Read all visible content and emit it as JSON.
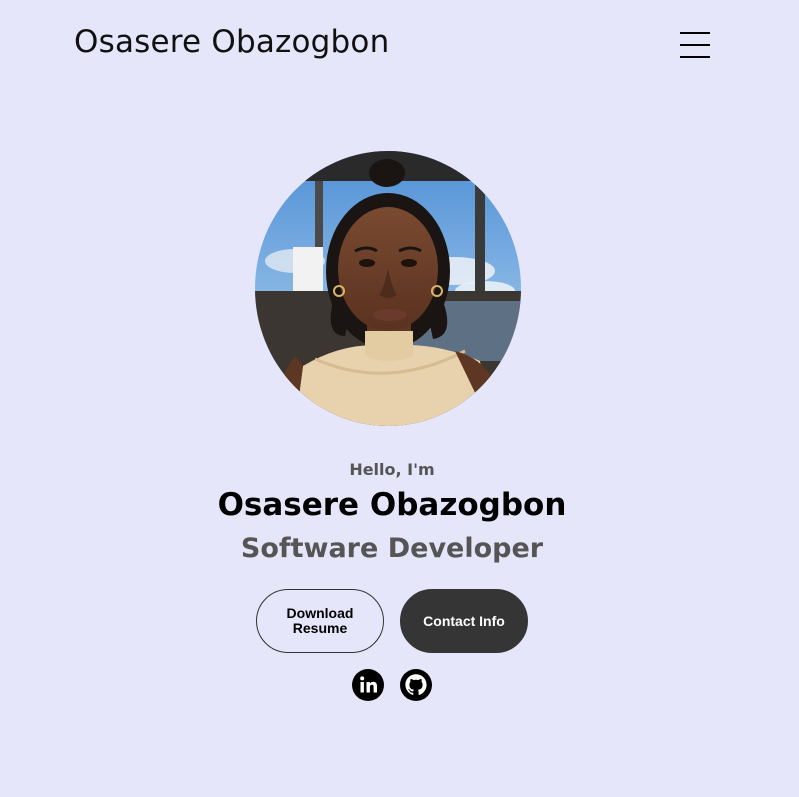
{
  "header": {
    "logo": "Osasere Obazogbon",
    "menu_icon": "hamburger-menu-icon"
  },
  "hero": {
    "greeting": "Hello, I'm",
    "name": "Osasere Obazogbon",
    "role": "Software Developer"
  },
  "buttons": {
    "resume_label": "Download Resume",
    "contact_label": "Contact Info"
  },
  "socials": [
    {
      "icon": "linkedin-icon"
    },
    {
      "icon": "github-icon"
    }
  ],
  "colors": {
    "background": "#e6e6fa",
    "primary_text": "#000000",
    "secondary_text": "#555555",
    "button_dark": "#353535",
    "button_text_light": "#ffffff"
  }
}
